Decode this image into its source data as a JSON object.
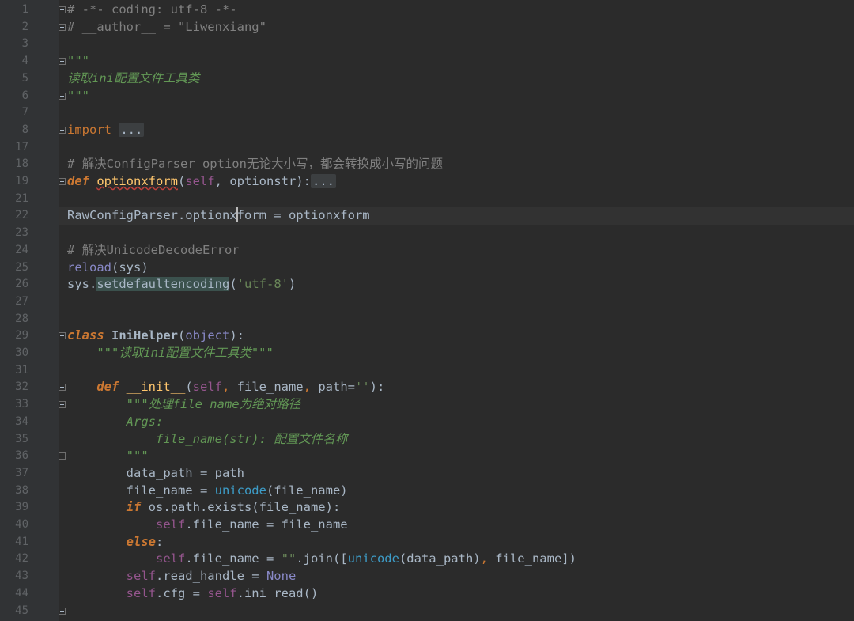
{
  "lines": [
    {
      "num": "1",
      "parts": [
        [
          "cm",
          "# -*- coding: utf-8 -*-"
        ]
      ]
    },
    {
      "num": "2",
      "parts": [
        [
          "cm",
          "# __author__ = \"Liwenxiang\""
        ]
      ]
    },
    {
      "num": "3",
      "parts": []
    },
    {
      "num": "4",
      "parts": [
        [
          "doc",
          "\"\"\""
        ]
      ]
    },
    {
      "num": "5",
      "parts": [
        [
          "doc",
          "读取ini配置文件工具类"
        ]
      ]
    },
    {
      "num": "6",
      "parts": [
        [
          "doc",
          "\"\"\""
        ]
      ]
    },
    {
      "num": "7",
      "parts": []
    },
    {
      "num": "8",
      "parts": [
        [
          "kw2",
          "import "
        ],
        [
          "fold",
          "..."
        ]
      ]
    },
    {
      "num": "17",
      "parts": []
    },
    {
      "num": "18",
      "parts": [
        [
          "cm",
          "# 解决ConfigParser option无论大小写，都会转换成小写的问题"
        ]
      ]
    },
    {
      "num": "19",
      "parts": [
        [
          "kw",
          "def "
        ],
        [
          "fn",
          "optionxform"
        ],
        [
          "",
          "("
        ],
        [
          "self",
          "self"
        ],
        [
          "",
          ", optionstr):"
        ],
        [
          "fold",
          "..."
        ]
      ]
    },
    {
      "num": "21",
      "parts": []
    },
    {
      "num": "22",
      "parts": [
        [
          "",
          "RawConfigParser.optionx"
        ],
        [
          "caret",
          ""
        ],
        [
          "",
          "form = optionxform"
        ]
      ]
    },
    {
      "num": "23",
      "parts": []
    },
    {
      "num": "24",
      "parts": [
        [
          "cm",
          "# 解决UnicodeDecodeError"
        ]
      ]
    },
    {
      "num": "25",
      "parts": [
        [
          "bi",
          "reload"
        ],
        [
          "",
          "(sys)"
        ]
      ]
    },
    {
      "num": "26",
      "parts": [
        [
          "",
          "sys."
        ],
        [
          "hl",
          "setdefaultencoding"
        ],
        [
          "",
          "("
        ],
        [
          "str",
          "'utf-8'"
        ],
        [
          "",
          ")"
        ]
      ]
    },
    {
      "num": "27",
      "parts": []
    },
    {
      "num": "28",
      "parts": []
    },
    {
      "num": "29",
      "parts": [
        [
          "kw",
          "class "
        ],
        [
          "cls",
          "IniHelper"
        ],
        [
          "",
          "("
        ],
        [
          "bi",
          "object"
        ],
        [
          "",
          "):"
        ]
      ]
    },
    {
      "num": "30",
      "parts": [
        [
          "ws",
          "    "
        ],
        [
          "doc",
          "\"\"\"读取ini配置文件工具类\"\"\""
        ]
      ]
    },
    {
      "num": "31",
      "parts": []
    },
    {
      "num": "32",
      "parts": [
        [
          "ws",
          "    "
        ],
        [
          "kw",
          "def "
        ],
        [
          "fn",
          "__init__"
        ],
        [
          "",
          "("
        ],
        [
          "self",
          "self"
        ],
        [
          "kw2",
          ", "
        ],
        [
          "",
          "file_name"
        ],
        [
          "kw2",
          ", "
        ],
        [
          "",
          "path="
        ],
        [
          "str",
          "''"
        ],
        [
          "",
          "):"
        ]
      ]
    },
    {
      "num": "33",
      "parts": [
        [
          "ws",
          "        "
        ],
        [
          "doc",
          "\"\"\"处理file_name为绝对路径"
        ]
      ]
    },
    {
      "num": "34",
      "parts": [
        [
          "ws",
          "        "
        ],
        [
          "doc",
          "Args:"
        ]
      ]
    },
    {
      "num": "35",
      "parts": [
        [
          "ws",
          "            "
        ],
        [
          "doc",
          "file_name(str): 配置文件名称"
        ]
      ]
    },
    {
      "num": "36",
      "parts": [
        [
          "ws",
          "        "
        ],
        [
          "doc",
          "\"\"\""
        ]
      ]
    },
    {
      "num": "37",
      "parts": [
        [
          "ws",
          "        "
        ],
        [
          "",
          "data_path = path"
        ]
      ]
    },
    {
      "num": "38",
      "parts": [
        [
          "ws",
          "        "
        ],
        [
          "",
          "file_name = "
        ],
        [
          "bi2",
          "unicode"
        ],
        [
          "",
          "(file_name)"
        ]
      ]
    },
    {
      "num": "39",
      "parts": [
        [
          "ws",
          "        "
        ],
        [
          "kw",
          "if "
        ],
        [
          "",
          "os.path.exists(file_name):"
        ]
      ]
    },
    {
      "num": "40",
      "parts": [
        [
          "ws",
          "            "
        ],
        [
          "self",
          "self"
        ],
        [
          "",
          ".file_name = file_name"
        ]
      ]
    },
    {
      "num": "41",
      "parts": [
        [
          "ws",
          "        "
        ],
        [
          "kw",
          "else"
        ],
        [
          "",
          ":"
        ]
      ]
    },
    {
      "num": "42",
      "parts": [
        [
          "ws",
          "            "
        ],
        [
          "self",
          "self"
        ],
        [
          "",
          ".file_name = "
        ],
        [
          "str",
          "\"\""
        ],
        [
          "",
          ".join(["
        ],
        [
          "bi2",
          "unicode"
        ],
        [
          "",
          "(data_path)"
        ],
        [
          "kw2",
          ", "
        ],
        [
          "",
          "file_name])"
        ]
      ]
    },
    {
      "num": "43",
      "parts": [
        [
          "ws",
          "        "
        ],
        [
          "self",
          "self"
        ],
        [
          "",
          ".read_handle = "
        ],
        [
          "none",
          "None"
        ]
      ]
    },
    {
      "num": "44",
      "parts": [
        [
          "ws",
          "        "
        ],
        [
          "self",
          "self"
        ],
        [
          "",
          ".cfg = "
        ],
        [
          "self",
          "self"
        ],
        [
          "",
          ".ini_read()"
        ]
      ]
    },
    {
      "num": "45",
      "parts": []
    }
  ],
  "current_line": "22",
  "colors": {
    "background": "#2b2b2b",
    "gutter": "#313335",
    "keyword": "#cc7832",
    "comment": "#808080",
    "docstring": "#629755",
    "string": "#6a8759",
    "function": "#ffc66d",
    "builtin": "#8888c6",
    "self": "#94558d"
  }
}
